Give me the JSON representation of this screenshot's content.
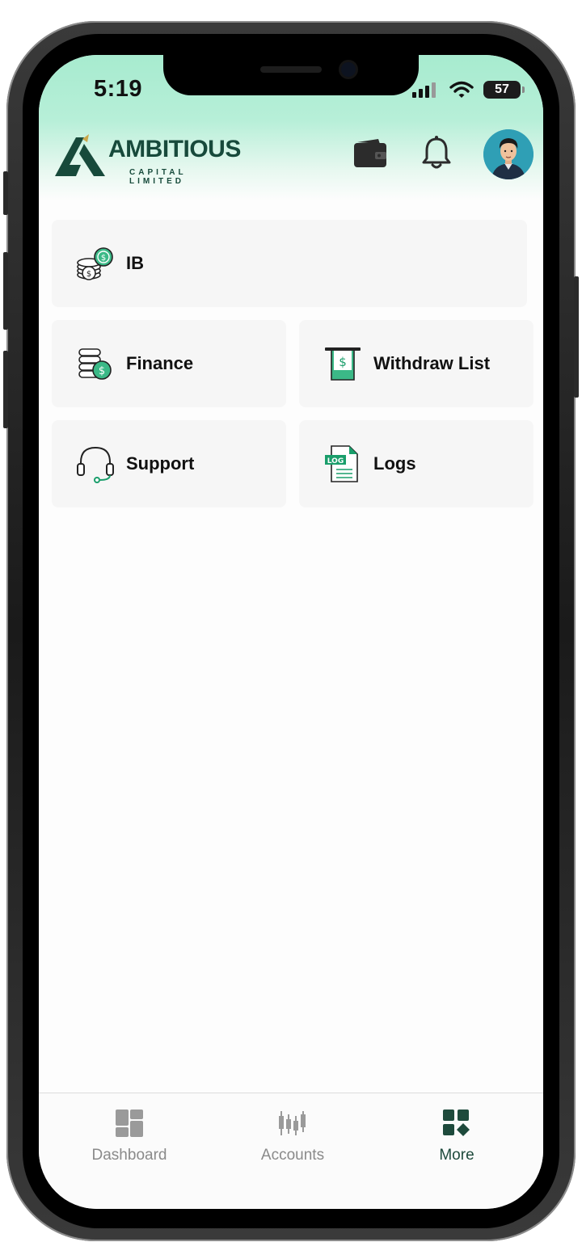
{
  "status_bar": {
    "time": "5:19",
    "battery": "57"
  },
  "header": {
    "logo_title": "AMBITIOUS",
    "logo_subtitle": "CAPITAL LIMITED",
    "wallet_icon": "wallet-icon",
    "bell_icon": "bell-icon",
    "avatar_icon": "user-avatar"
  },
  "menu": {
    "ib": {
      "label": "IB",
      "icon": "coins-stack-icon"
    },
    "finance": {
      "label": "Finance",
      "icon": "finance-coins-icon"
    },
    "withdraw_list": {
      "label": "Withdraw List",
      "icon": "withdraw-icon"
    },
    "support": {
      "label": "Support",
      "icon": "headset-icon"
    },
    "logs": {
      "label": "Logs",
      "icon": "log-file-icon"
    }
  },
  "tabbar": {
    "items": [
      {
        "label": "Dashboard",
        "icon": "dashboard-icon",
        "active": false
      },
      {
        "label": "Accounts",
        "icon": "candlestick-icon",
        "active": false
      },
      {
        "label": "More",
        "icon": "grid-more-icon",
        "active": true
      }
    ]
  },
  "colors": {
    "brand_dark_green": "#174a3b",
    "accent_green": "#1a9e6b",
    "header_mint": "#a7ebcf",
    "card_bg": "#f6f6f6",
    "tab_inactive": "#8a8a8a"
  }
}
